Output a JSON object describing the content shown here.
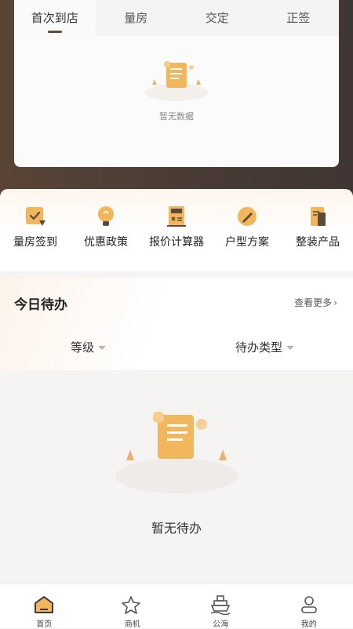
{
  "tabs": [
    {
      "label": "首次到店"
    },
    {
      "label": "量房"
    },
    {
      "label": "交定"
    },
    {
      "label": "正签"
    }
  ],
  "top_empty": {
    "text": "暂无数据"
  },
  "quick_menu": [
    {
      "label": "量房签到",
      "icon": "checkin-icon"
    },
    {
      "label": "优惠政策",
      "icon": "lightbulb-icon"
    },
    {
      "label": "报价计算器",
      "icon": "calculator-icon"
    },
    {
      "label": "户型方案",
      "icon": "pencil-icon"
    },
    {
      "label": "整装产品",
      "icon": "document-icon"
    }
  ],
  "todo": {
    "title": "今日待办",
    "more": "查看更多",
    "filters": [
      {
        "label": "等级"
      },
      {
        "label": "待办类型"
      }
    ]
  },
  "todo_empty": {
    "text": "暂无待办"
  },
  "nav": [
    {
      "label": "首页",
      "icon": "home-icon"
    },
    {
      "label": "商机",
      "icon": "star-icon"
    },
    {
      "label": "公海",
      "icon": "ship-icon"
    },
    {
      "label": "我的",
      "icon": "user-icon"
    }
  ],
  "colors": {
    "accent": "#f0a93f",
    "dark": "#5d4a3c",
    "header_bg": "#4a3c35"
  }
}
